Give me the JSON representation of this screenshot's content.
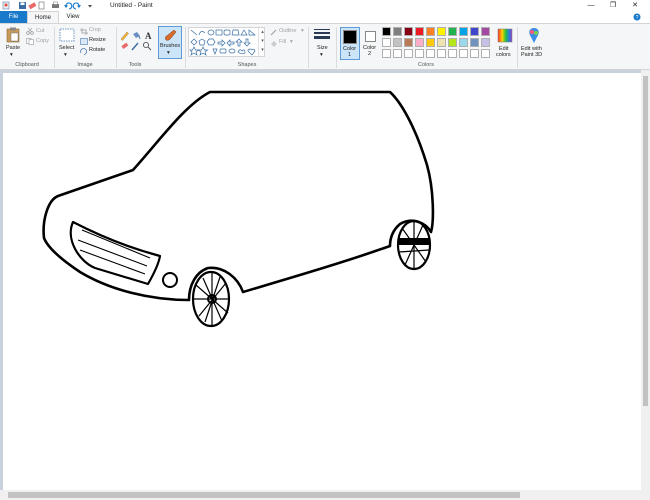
{
  "window": {
    "title": "Untitled - Paint",
    "minimize_glyph": "—",
    "maximize_glyph": "❐",
    "close_glyph": "✕"
  },
  "tabs": [
    {
      "label": "File"
    },
    {
      "label": "Home"
    },
    {
      "label": "View"
    }
  ],
  "ribbon": {
    "clipboard": {
      "paste": "Paste",
      "cut": "Cut",
      "copy": "Copy",
      "group": "Clipboard"
    },
    "image": {
      "select": "Select",
      "crop": "Crop",
      "resize": "Resize",
      "rotate": "Rotate",
      "group": "Image"
    },
    "tools": {
      "group": "Tools"
    },
    "brushes": {
      "label": "Brushes"
    },
    "shapes": {
      "outline": "Outline",
      "fill": "Fill",
      "group": "Shapes"
    },
    "size": {
      "label": "Size"
    },
    "color1": {
      "label_top": "Color",
      "label_bottom": "1"
    },
    "color2": {
      "label_top": "Color",
      "label_bottom": "2"
    },
    "colors_group": "Colors",
    "edit_colors": {
      "top": "Edit",
      "bottom": "colors"
    },
    "paint3d": {
      "top": "Edit with",
      "bottom": "Paint 3D"
    }
  },
  "palette_row1": [
    "#000000",
    "#7f7f7f",
    "#880015",
    "#ed1c24",
    "#ff7f27",
    "#fff200",
    "#22b14c",
    "#00a2e8",
    "#3f48cc",
    "#a349a4"
  ],
  "palette_row2": [
    "#ffffff",
    "#c3c3c3",
    "#b97a57",
    "#ffaec9",
    "#ffc90e",
    "#efe4b0",
    "#b5e61d",
    "#99d9ea",
    "#7092be",
    "#c8bfe7"
  ],
  "colors": {
    "accent": "#1979ca",
    "color1": "#000000",
    "color2": "#ffffff"
  }
}
